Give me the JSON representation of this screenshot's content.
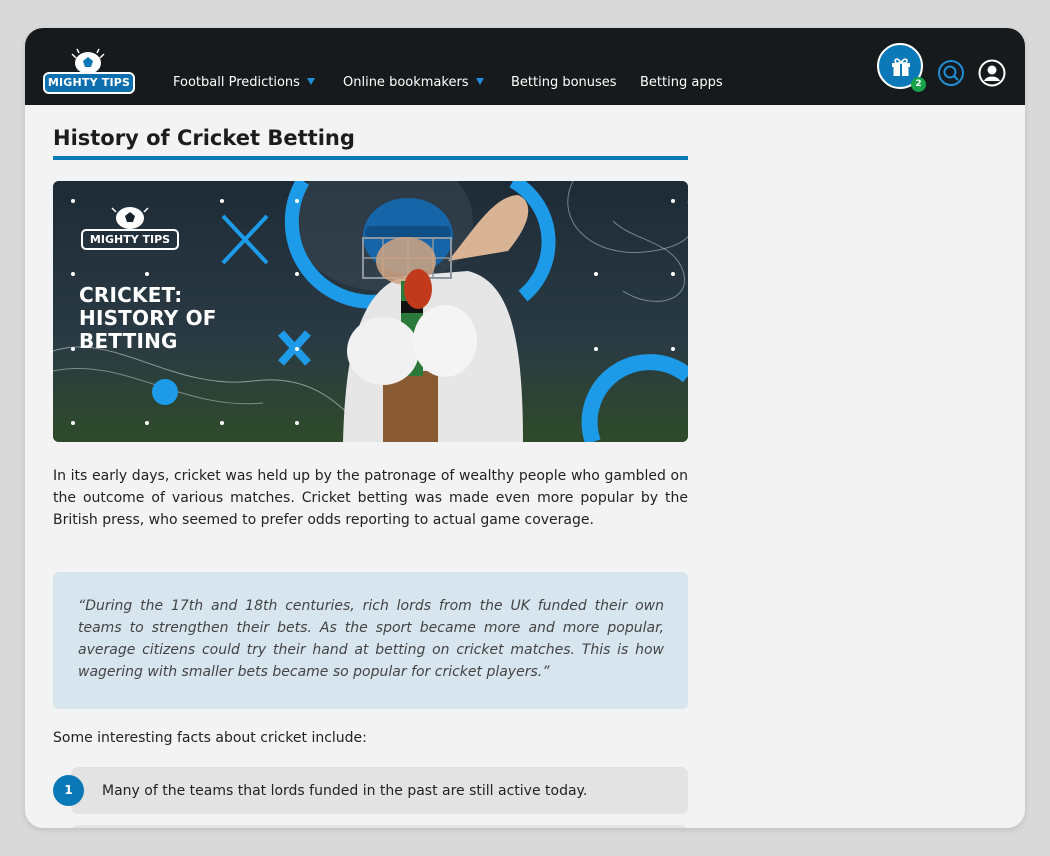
{
  "brand": {
    "logo_text": "MIGHTY TIPS"
  },
  "nav": {
    "items": [
      {
        "label": "Football Predictions",
        "has_dropdown": true
      },
      {
        "label": "Online bookmakers",
        "has_dropdown": true
      },
      {
        "label": "Betting bonuses",
        "has_dropdown": false
      },
      {
        "label": "Betting apps",
        "has_dropdown": false
      }
    ],
    "gift_badge_count": "2",
    "icons": [
      "gift-icon",
      "search-icon",
      "user-icon"
    ]
  },
  "article": {
    "title": "History of Cricket Betting",
    "hero": {
      "logo_text": "MIGHTY TIPS",
      "headline": "CRICKET:\nHISTORY OF\nBETTING"
    },
    "intro": "In its early days, cricket was held up by the patronage of wealthy people who gambled on the outcome of various matches. Cricket betting was made even more popular by the British press, who seemed to prefer odds reporting to actual game coverage.",
    "quote": "“During the 17th and 18th centuries, rich lords from the UK funded their own teams to strengthen their bets. As the sport became more and more popular, average citizens could try their hand at betting on cricket matches. This is how wagering with smaller bets became so popular for cricket players.”",
    "facts_intro": "Some interesting facts about cricket include:",
    "facts": [
      {
        "number": "1",
        "text": "Many of the teams that lords funded in the past are still active today."
      }
    ]
  },
  "colors": {
    "accent": "#0b78b8",
    "navbar": "#171a1c",
    "quote_bg": "#d7e5ee",
    "badge": "#16a34a"
  }
}
